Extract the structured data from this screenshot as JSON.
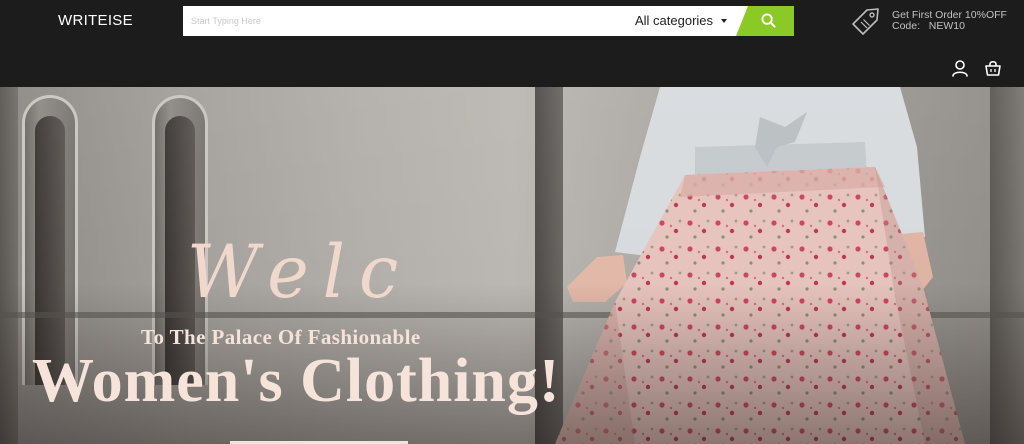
{
  "header": {
    "logo": "WRITEISE",
    "search": {
      "placeholder": "Start Typing Here",
      "value": "",
      "category": "All categories",
      "button_icon": "search-icon",
      "button_color": "#8ac926"
    },
    "promo": {
      "icon": "tag-icon",
      "line1": "Get First Order 10%OFF",
      "line2": "Code:   NEW10"
    },
    "icons": [
      "user-icon",
      "cart-icon"
    ]
  },
  "hero": {
    "script_text": "Welc",
    "subtitle": "To The Palace Of Fashionable",
    "title": "Women's Clothing!"
  },
  "colors": {
    "header_bg": "#1c1c1c",
    "accent": "#8ac926",
    "hero_text": "#f6e4da"
  }
}
